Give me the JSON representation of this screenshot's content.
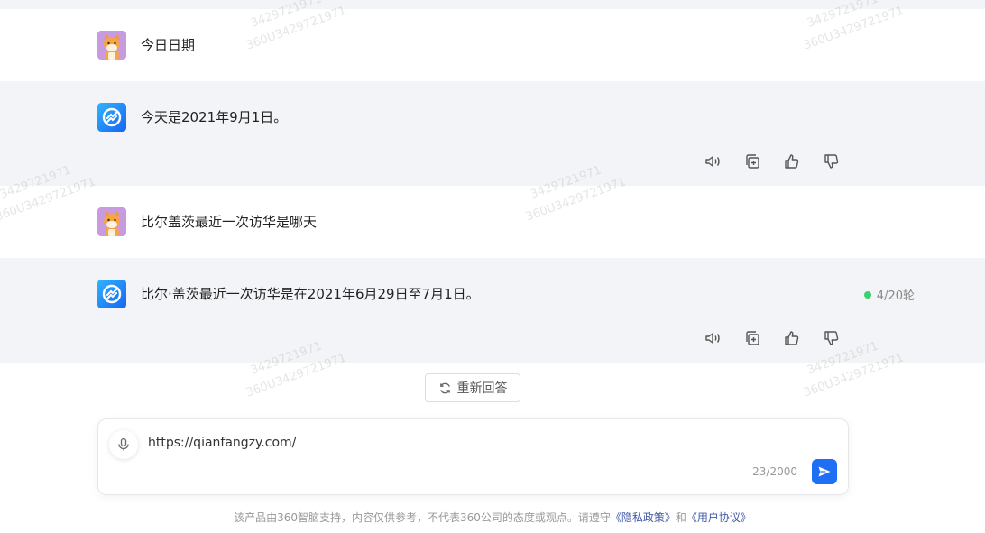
{
  "messages": [
    {
      "role": "user",
      "text": "今日日期"
    },
    {
      "role": "assistant",
      "text": "今天是2021年9月1日。"
    },
    {
      "role": "user",
      "text": "比尔盖茨最近一次访华是哪天"
    },
    {
      "role": "assistant",
      "text": "比尔·盖茨最近一次访华是在2021年6月29日至7月1日。"
    }
  ],
  "turn_counter": "4/20轮",
  "turn_status_color": "#3bd16f",
  "regenerate_label": "重新回答",
  "input": {
    "value": "https://qianfangzy.com/",
    "char_count": "23/2000"
  },
  "footer": {
    "prefix": "该产品由360智脑支持，内容仅供参考，不代表360公司的态度或观点。请遵守",
    "privacy_link": "《隐私政策》",
    "and": "和",
    "terms_link": "《用户协议》"
  },
  "watermark": {
    "line1": "3429721971",
    "line2": "360U3429721971"
  },
  "colors": {
    "accent": "#1f6ff5",
    "bot_row_bg": "#f3f4f7",
    "user_avatar_bg": "#c89be0"
  },
  "icons": [
    "speaker-icon",
    "copy-icon",
    "thumbs-up-icon",
    "thumbs-down-icon",
    "refresh-icon",
    "microphone-icon",
    "send-icon"
  ]
}
